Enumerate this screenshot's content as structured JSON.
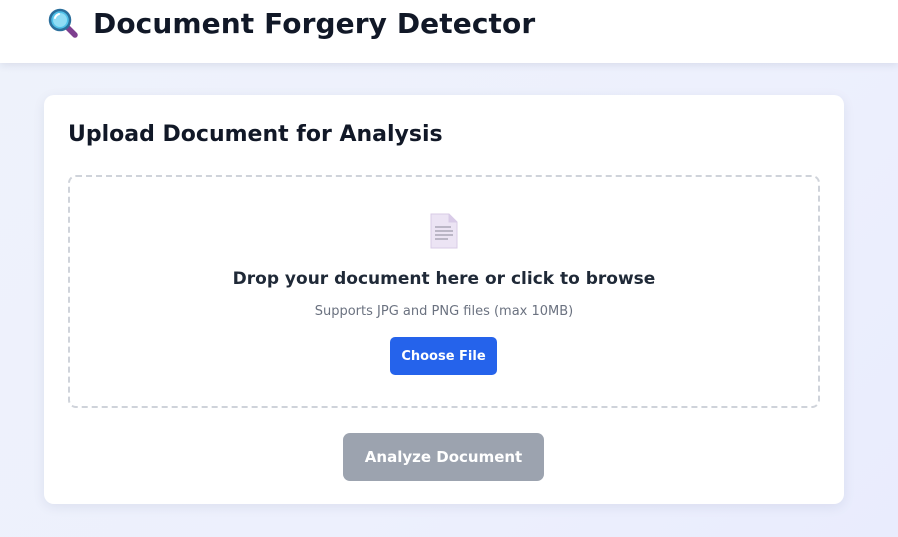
{
  "header": {
    "icon": "magnifying-glass-icon",
    "title": "Document Forgery Detector"
  },
  "upload": {
    "title": "Upload Document for Analysis",
    "dropzone": {
      "icon": "document-icon",
      "prompt": "Drop your document here or click to browse",
      "supports": "Supports JPG and PNG files (max 10MB)",
      "choose_label": "Choose File"
    },
    "analyze_label": "Analyze Document",
    "analyze_disabled": true
  },
  "colors": {
    "primary": "#2563eb",
    "disabled": "#9ca3af",
    "page_background": "#eef1fc",
    "dropzone_border": "#cfd3da"
  }
}
